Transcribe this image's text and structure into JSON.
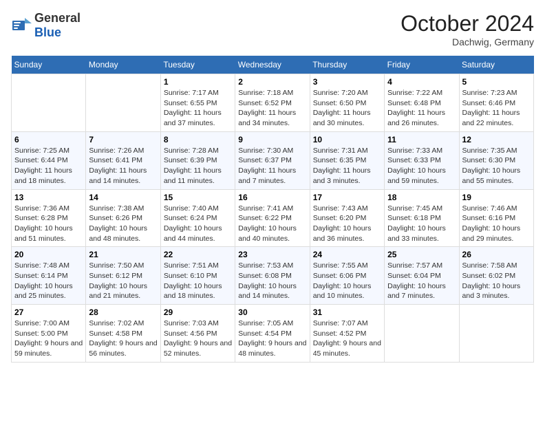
{
  "header": {
    "logo_general": "General",
    "logo_blue": "Blue",
    "month_title": "October 2024",
    "location": "Dachwig, Germany"
  },
  "calendar": {
    "days_of_week": [
      "Sunday",
      "Monday",
      "Tuesday",
      "Wednesday",
      "Thursday",
      "Friday",
      "Saturday"
    ],
    "weeks": [
      [
        {
          "day": "",
          "info": ""
        },
        {
          "day": "",
          "info": ""
        },
        {
          "day": "1",
          "info": "Sunrise: 7:17 AM\nSunset: 6:55 PM\nDaylight: 11 hours and 37 minutes."
        },
        {
          "day": "2",
          "info": "Sunrise: 7:18 AM\nSunset: 6:52 PM\nDaylight: 11 hours and 34 minutes."
        },
        {
          "day": "3",
          "info": "Sunrise: 7:20 AM\nSunset: 6:50 PM\nDaylight: 11 hours and 30 minutes."
        },
        {
          "day": "4",
          "info": "Sunrise: 7:22 AM\nSunset: 6:48 PM\nDaylight: 11 hours and 26 minutes."
        },
        {
          "day": "5",
          "info": "Sunrise: 7:23 AM\nSunset: 6:46 PM\nDaylight: 11 hours and 22 minutes."
        }
      ],
      [
        {
          "day": "6",
          "info": "Sunrise: 7:25 AM\nSunset: 6:44 PM\nDaylight: 11 hours and 18 minutes."
        },
        {
          "day": "7",
          "info": "Sunrise: 7:26 AM\nSunset: 6:41 PM\nDaylight: 11 hours and 14 minutes."
        },
        {
          "day": "8",
          "info": "Sunrise: 7:28 AM\nSunset: 6:39 PM\nDaylight: 11 hours and 11 minutes."
        },
        {
          "day": "9",
          "info": "Sunrise: 7:30 AM\nSunset: 6:37 PM\nDaylight: 11 hours and 7 minutes."
        },
        {
          "day": "10",
          "info": "Sunrise: 7:31 AM\nSunset: 6:35 PM\nDaylight: 11 hours and 3 minutes."
        },
        {
          "day": "11",
          "info": "Sunrise: 7:33 AM\nSunset: 6:33 PM\nDaylight: 10 hours and 59 minutes."
        },
        {
          "day": "12",
          "info": "Sunrise: 7:35 AM\nSunset: 6:30 PM\nDaylight: 10 hours and 55 minutes."
        }
      ],
      [
        {
          "day": "13",
          "info": "Sunrise: 7:36 AM\nSunset: 6:28 PM\nDaylight: 10 hours and 51 minutes."
        },
        {
          "day": "14",
          "info": "Sunrise: 7:38 AM\nSunset: 6:26 PM\nDaylight: 10 hours and 48 minutes."
        },
        {
          "day": "15",
          "info": "Sunrise: 7:40 AM\nSunset: 6:24 PM\nDaylight: 10 hours and 44 minutes."
        },
        {
          "day": "16",
          "info": "Sunrise: 7:41 AM\nSunset: 6:22 PM\nDaylight: 10 hours and 40 minutes."
        },
        {
          "day": "17",
          "info": "Sunrise: 7:43 AM\nSunset: 6:20 PM\nDaylight: 10 hours and 36 minutes."
        },
        {
          "day": "18",
          "info": "Sunrise: 7:45 AM\nSunset: 6:18 PM\nDaylight: 10 hours and 33 minutes."
        },
        {
          "day": "19",
          "info": "Sunrise: 7:46 AM\nSunset: 6:16 PM\nDaylight: 10 hours and 29 minutes."
        }
      ],
      [
        {
          "day": "20",
          "info": "Sunrise: 7:48 AM\nSunset: 6:14 PM\nDaylight: 10 hours and 25 minutes."
        },
        {
          "day": "21",
          "info": "Sunrise: 7:50 AM\nSunset: 6:12 PM\nDaylight: 10 hours and 21 minutes."
        },
        {
          "day": "22",
          "info": "Sunrise: 7:51 AM\nSunset: 6:10 PM\nDaylight: 10 hours and 18 minutes."
        },
        {
          "day": "23",
          "info": "Sunrise: 7:53 AM\nSunset: 6:08 PM\nDaylight: 10 hours and 14 minutes."
        },
        {
          "day": "24",
          "info": "Sunrise: 7:55 AM\nSunset: 6:06 PM\nDaylight: 10 hours and 10 minutes."
        },
        {
          "day": "25",
          "info": "Sunrise: 7:57 AM\nSunset: 6:04 PM\nDaylight: 10 hours and 7 minutes."
        },
        {
          "day": "26",
          "info": "Sunrise: 7:58 AM\nSunset: 6:02 PM\nDaylight: 10 hours and 3 minutes."
        }
      ],
      [
        {
          "day": "27",
          "info": "Sunrise: 7:00 AM\nSunset: 5:00 PM\nDaylight: 9 hours and 59 minutes."
        },
        {
          "day": "28",
          "info": "Sunrise: 7:02 AM\nSunset: 4:58 PM\nDaylight: 9 hours and 56 minutes."
        },
        {
          "day": "29",
          "info": "Sunrise: 7:03 AM\nSunset: 4:56 PM\nDaylight: 9 hours and 52 minutes."
        },
        {
          "day": "30",
          "info": "Sunrise: 7:05 AM\nSunset: 4:54 PM\nDaylight: 9 hours and 48 minutes."
        },
        {
          "day": "31",
          "info": "Sunrise: 7:07 AM\nSunset: 4:52 PM\nDaylight: 9 hours and 45 minutes."
        },
        {
          "day": "",
          "info": ""
        },
        {
          "day": "",
          "info": ""
        }
      ]
    ]
  }
}
